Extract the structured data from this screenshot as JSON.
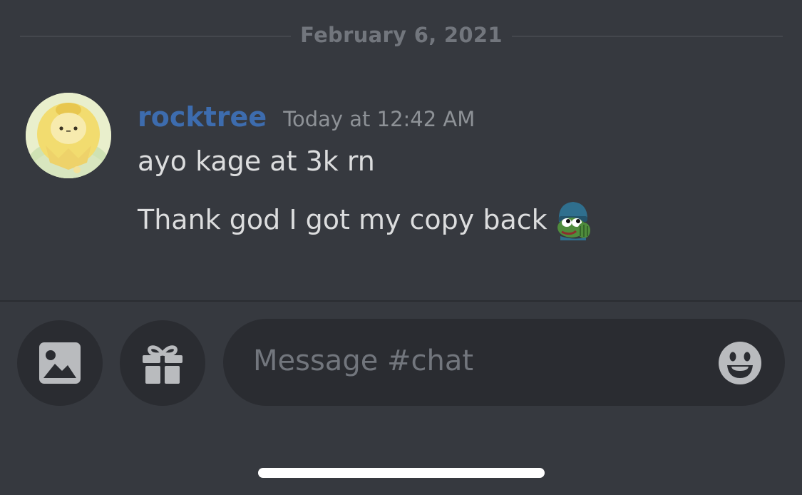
{
  "divider": {
    "date": "February 6, 2021"
  },
  "message": {
    "author": "rocktree",
    "timestamp": "Today at 12:42 AM",
    "lines": [
      "ayo kage at 3k rn",
      "Thank god I got my copy back"
    ],
    "avatar_icon": "plush-avatar",
    "emote_icon": "pepe-beanie-emote",
    "author_color": "#3d6cae"
  },
  "composer": {
    "placeholder": "Message #chat",
    "image_button_icon": "image-icon",
    "gift_button_icon": "gift-icon",
    "emoji_button_icon": "emoji-icon"
  }
}
